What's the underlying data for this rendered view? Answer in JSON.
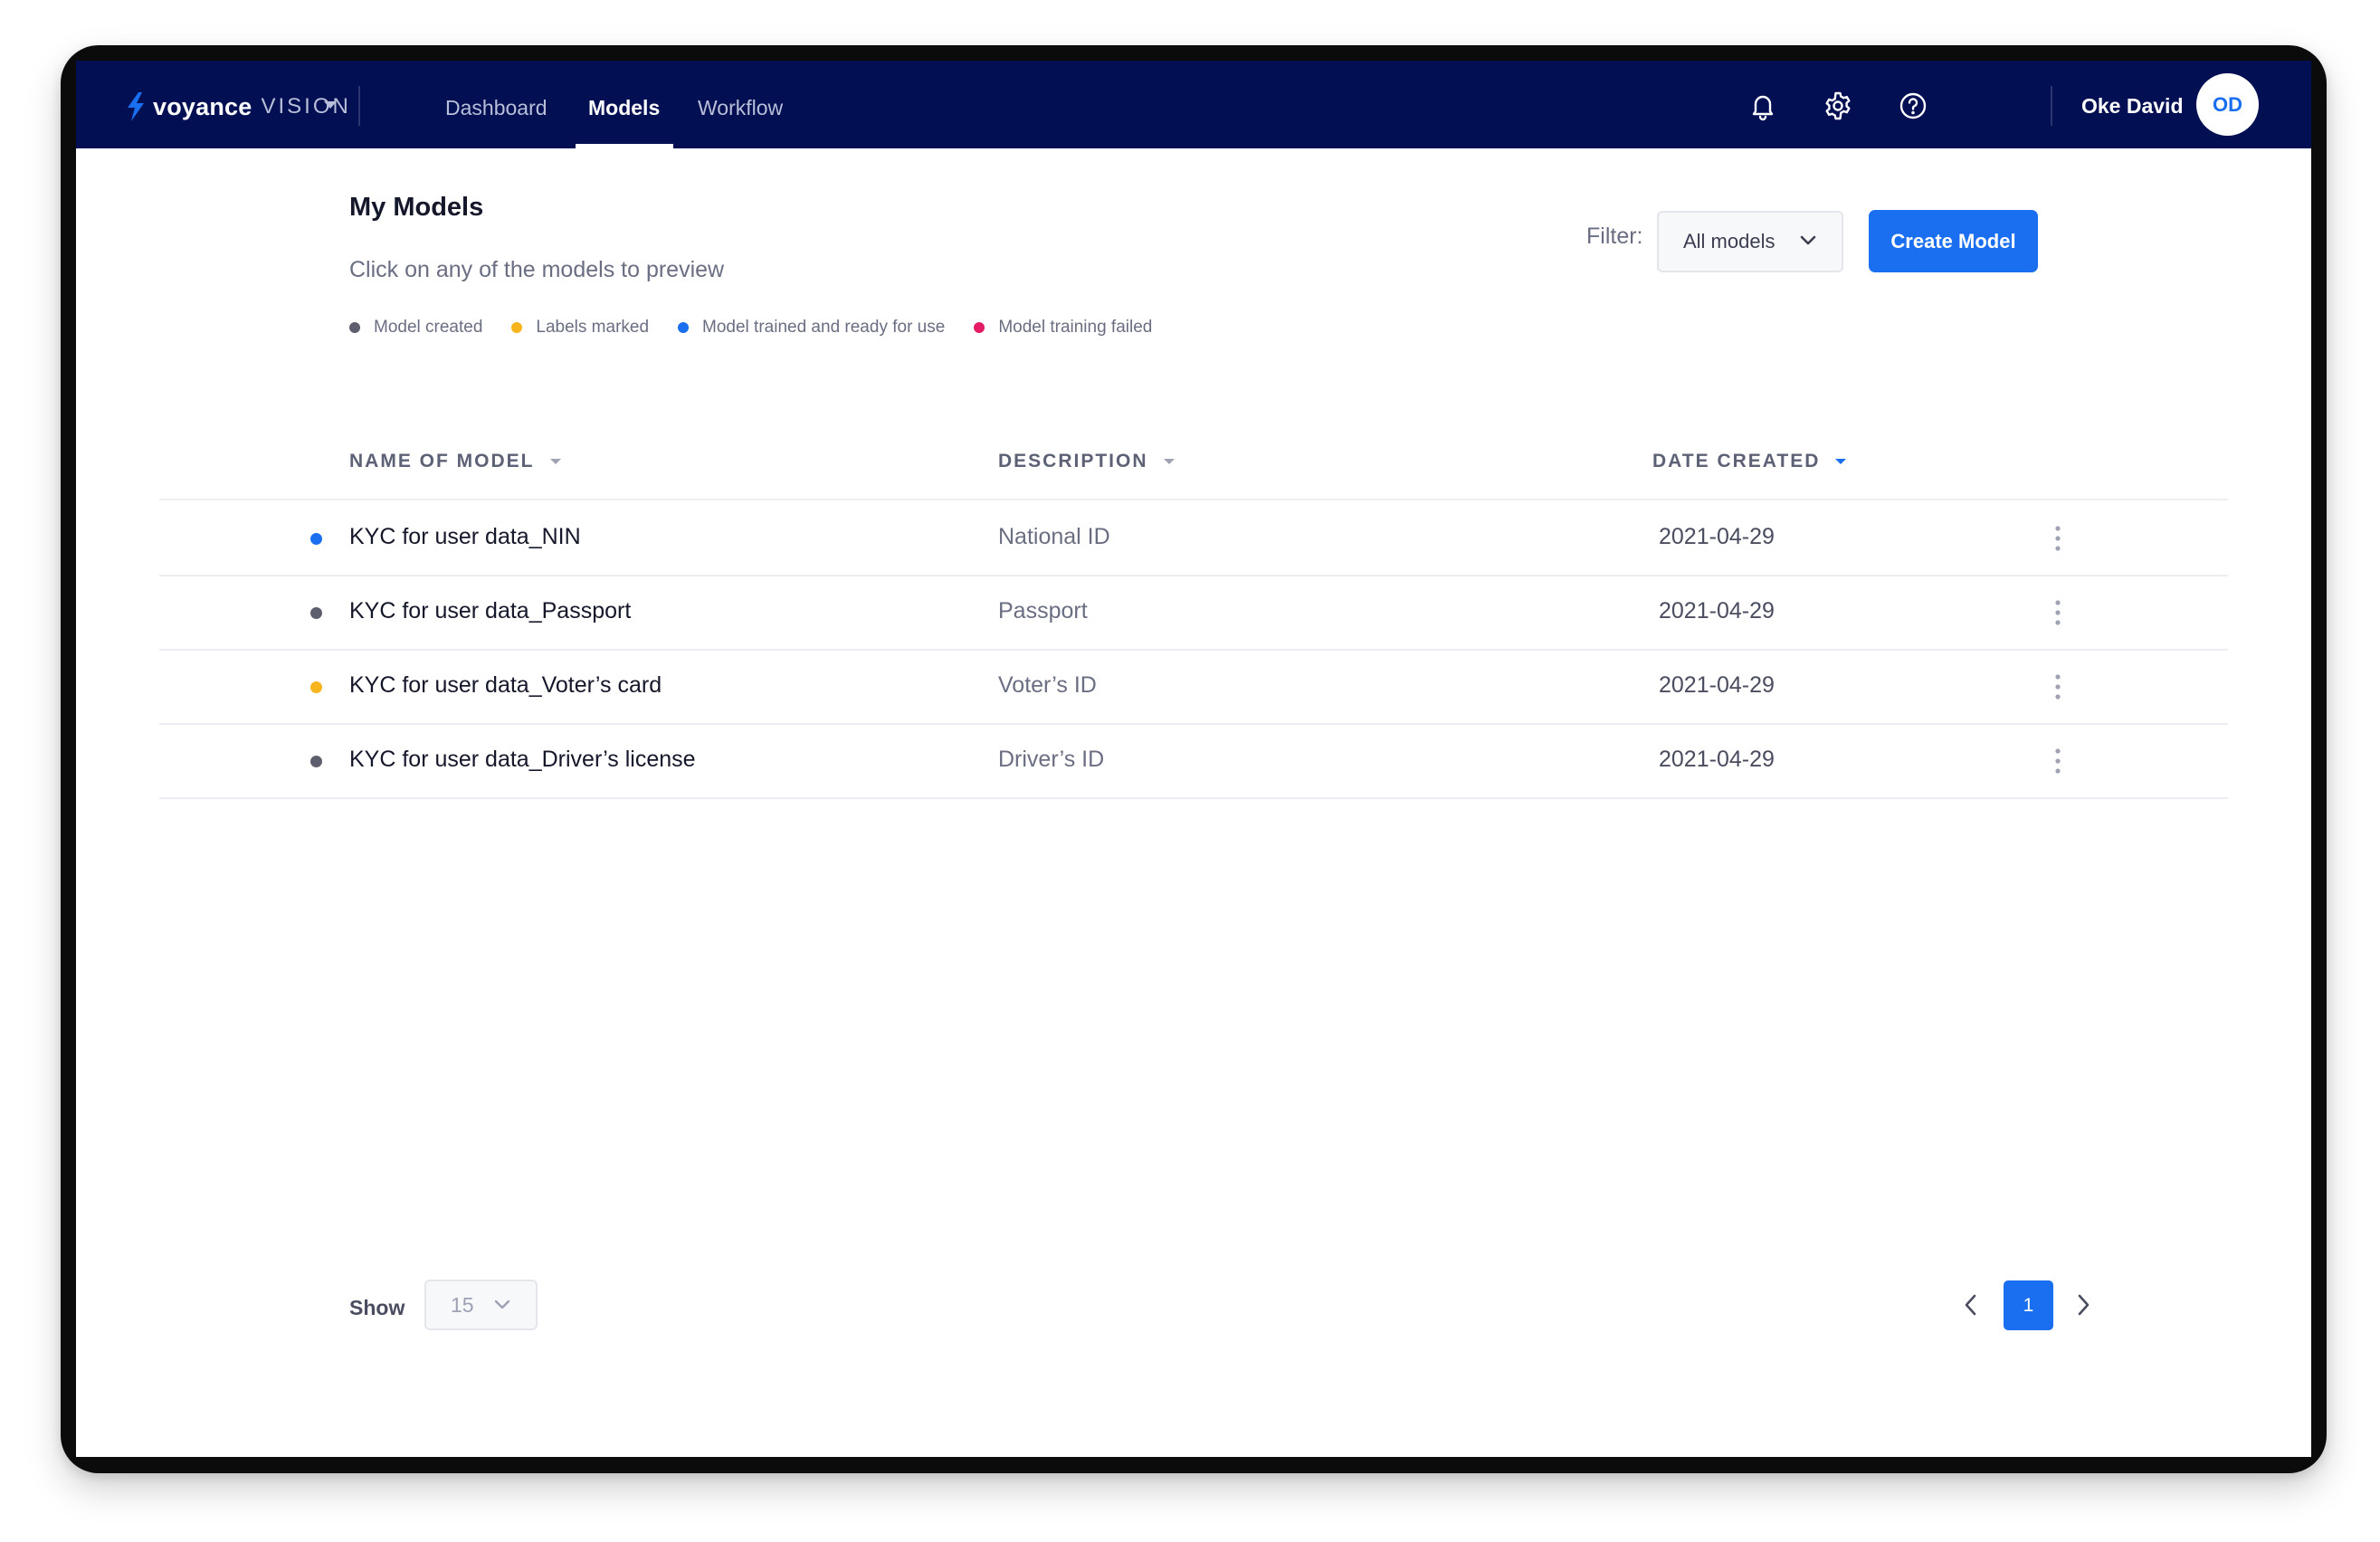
{
  "app": {
    "brand": "voyance",
    "product": "VISION"
  },
  "nav": {
    "tabs": [
      {
        "label": "Dashboard"
      },
      {
        "label": "Models"
      },
      {
        "label": "Workflow"
      }
    ],
    "active_tab": "Models",
    "icons": [
      "bell-icon",
      "gear-icon",
      "help-icon"
    ],
    "user": {
      "name": "Oke David",
      "initials": "OD"
    }
  },
  "header": {
    "title": "My Models",
    "subtitle": "Click on any of the models to preview",
    "filter_label": "Filter:",
    "filter_value": "All models",
    "create_button": "Create Model"
  },
  "legend": [
    {
      "label": "Model created",
      "color": "#5d5e6e"
    },
    {
      "label": "Labels marked",
      "color": "#f6b51d"
    },
    {
      "label": "Model trained and ready for use",
      "color": "#1a6ff0"
    },
    {
      "label": "Model training failed",
      "color": "#e51c64"
    }
  ],
  "table": {
    "columns": [
      "NAME OF MODEL",
      "DESCRIPTION",
      "DATE CREATED"
    ],
    "sorted_column": "DATE CREATED",
    "rows": [
      {
        "name": "KYC for user data_NIN",
        "description": "National ID",
        "date": "2021-04-29",
        "status": "trained",
        "status_color": "#1a6ff0"
      },
      {
        "name": "KYC for user data_Passport",
        "description": "Passport",
        "date": "2021-04-29",
        "status": "created",
        "status_color": "#5d5e6e"
      },
      {
        "name": "KYC for user data_Voter’s card",
        "description": "Voter’s ID",
        "date": "2021-04-29",
        "status": "labels",
        "status_color": "#f6b51d"
      },
      {
        "name": "KYC for user data_Driver’s license",
        "description": "Driver’s ID",
        "date": "2021-04-29",
        "status": "created",
        "status_color": "#5d5e6e"
      }
    ]
  },
  "footer": {
    "show_label": "Show",
    "page_size": "15",
    "current_page": "1"
  }
}
